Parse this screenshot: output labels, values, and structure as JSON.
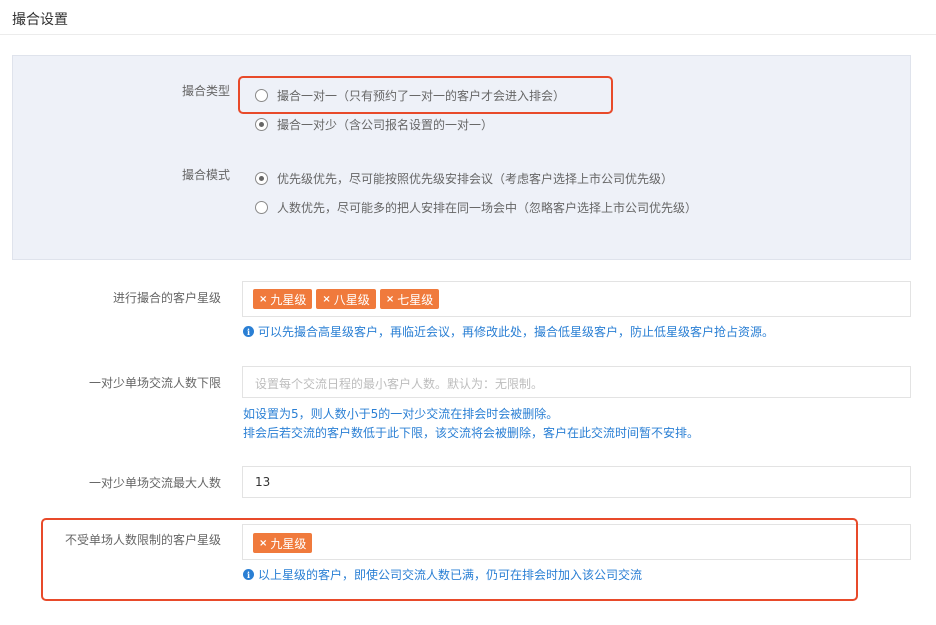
{
  "page": {
    "title": "撮合设置"
  },
  "match_type": {
    "label": "撮合类型",
    "options": [
      {
        "label": "撮合一对一（只有预约了一对一的客户才会进入排会）",
        "checked": false
      },
      {
        "label": "撮合一对少（含公司报名设置的一对一）",
        "checked": true
      }
    ]
  },
  "match_mode": {
    "label": "撮合模式",
    "options": [
      {
        "label": "优先级优先，尽可能按照优先级安排会议（考虑客户选择上市公司优先级）",
        "checked": true
      },
      {
        "label": "人数优先，尽可能多的把人安排在同一场会中（忽略客户选择上市公司优先级）",
        "checked": false
      }
    ]
  },
  "star_levels": {
    "label": "进行撮合的客户星级",
    "tags": [
      "九星级",
      "八星级",
      "七星级"
    ],
    "hint": "可以先撮合高星级客户，再临近会议，再修改此处，撮合低星级客户，防止低星级客户抢占资源。"
  },
  "min_people": {
    "label": "一对少单场交流人数下限",
    "placeholder": "设置每个交流日程的最小客户人数。默认为：无限制。",
    "hint_line1": "如设置为5，则人数小于5的一对少交流在排会时会被删除。",
    "hint_line2": "排会后若交流的客户数低于此下限，该交流将会被删除，客户在此交流时间暂不安排。"
  },
  "max_people": {
    "label": "一对少单场交流最大人数",
    "value": "13"
  },
  "unlimited_levels": {
    "label": "不受单场人数限制的客户星级",
    "tags": [
      "九星级"
    ],
    "hint": "以上星级的客户，即使公司交流人数已满，仍可在排会时加入该公司交流"
  },
  "icons": {
    "tag_remove": "×",
    "info": "i"
  },
  "colors": {
    "tag": "#f07a3c",
    "hint": "#2a7fd4",
    "highlight": "#e84a2a",
    "panel": "#eef1f8"
  }
}
